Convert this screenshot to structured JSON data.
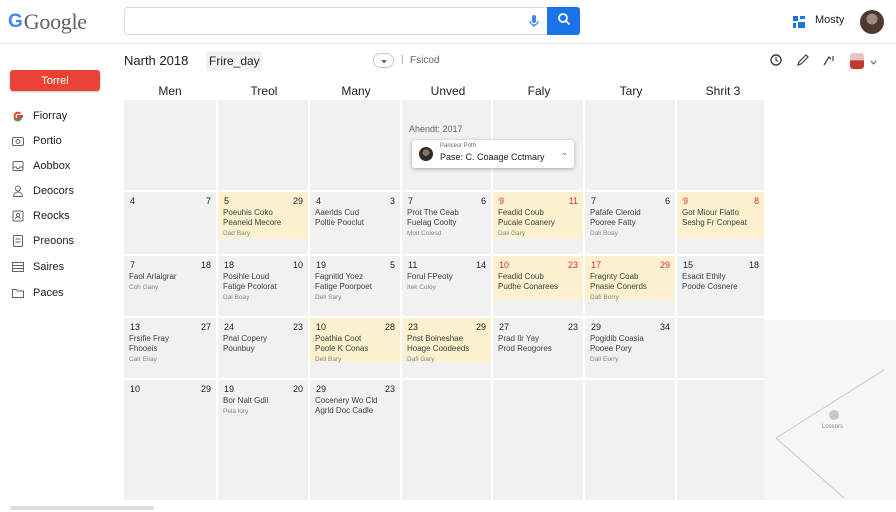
{
  "app": {
    "logo_g": "G",
    "logo_word": "Google"
  },
  "search": {
    "value": "",
    "placeholder": ""
  },
  "user": {
    "name": "Mosty"
  },
  "sidebar": {
    "create_label": "Torrel",
    "items": [
      {
        "label": "Fiorray",
        "icon": "google-g-icon"
      },
      {
        "label": "Portio",
        "icon": "camera-icon"
      },
      {
        "label": "Aobbox",
        "icon": "inbox-icon"
      },
      {
        "label": "Deocors",
        "icon": "person-icon"
      },
      {
        "label": "Reocks",
        "icon": "contacts-icon"
      },
      {
        "label": "Preoons",
        "icon": "document-icon"
      },
      {
        "label": "Saires",
        "icon": "list-icon"
      },
      {
        "label": "Paces",
        "icon": "folder-icon"
      }
    ]
  },
  "header": {
    "month": "Narth 2018",
    "view": "Frire_day",
    "filter": "Fsicod",
    "separator": "|"
  },
  "days_of_week": [
    "Men",
    "Treol",
    "Many",
    "Unved",
    "Faly",
    "Tary",
    "Shrit 3"
  ],
  "week0": {
    "label": "Ahendt: 2017",
    "popover": {
      "line1": "Pancesr Poth",
      "line2": "Pase: C. Coaage Cctmary"
    }
  },
  "weeks": [
    {
      "cells": [
        {
          "l": "4",
          "r": "7",
          "events": [],
          "hl": false
        },
        {
          "l": "5",
          "r": "29",
          "events": [
            "Poeuhis Coko",
            "Peaneid Mecore"
          ],
          "sub": "Dad Bary",
          "hl": true
        },
        {
          "l": "4",
          "r": "3",
          "events": [
            "Aaerlds Cud",
            "Poltie Pooclut"
          ],
          "sub": "",
          "hl": false
        },
        {
          "l": "7",
          "r": "6",
          "events": [
            "Prot The Ceab",
            "Fuelag Coolty"
          ],
          "sub": "Moit Colesd",
          "hl": false
        },
        {
          "l": "9",
          "r": "11",
          "events": [
            "Feadid Coub",
            "Pucale Coanery"
          ],
          "sub": "Dali Gary",
          "hl": true
        },
        {
          "l": "7",
          "r": "6",
          "events": [
            "Pafafe Cleroid",
            "Pooree Fatty"
          ],
          "sub": "Dali Boay",
          "hl": false
        },
        {
          "l": "9",
          "r": "8",
          "events": [
            "Got Miour Flatlo",
            "Seshg Fr Conpeat"
          ],
          "sub": "",
          "hl": true
        }
      ]
    },
    {
      "cells": [
        {
          "l": "7",
          "r": "18",
          "events": [
            "Faol Arlaigrar"
          ],
          "sub": "Coh Gany",
          "hl": false
        },
        {
          "l": "18",
          "r": "10",
          "events": [
            "Posihle Loud",
            "Fatige Pcolorat"
          ],
          "sub": "Dal Boay",
          "hl": false
        },
        {
          "l": "19",
          "r": "5",
          "events": [
            "Fagnitid Yoez",
            "Fatige Poorpoet"
          ],
          "sub": "Dell Sary",
          "hl": false
        },
        {
          "l": "11",
          "r": "14",
          "events": [
            "Forul FPeoty"
          ],
          "sub": "Itek Coloy",
          "hl": false
        },
        {
          "l": "10",
          "r": "23",
          "events": [
            "Feadid Coub",
            "Pudhe Conarees"
          ],
          "sub": "",
          "hl": true
        },
        {
          "l": "17",
          "r": "29",
          "events": [
            "Fragnty Coab",
            "Pnasie Conerds"
          ],
          "sub": "Dafi Borry",
          "hl": true
        },
        {
          "l": "15",
          "r": "18",
          "events": [
            "Esacit Ethily",
            "Poode Cosnere"
          ],
          "sub": "",
          "hl": false
        }
      ]
    },
    {
      "cells": [
        {
          "l": "13",
          "r": "27",
          "events": [
            "Frsifie Fray",
            "Fhooeis"
          ],
          "sub": "Cair Eilay",
          "hl": false
        },
        {
          "l": "24",
          "r": "23",
          "events": [
            "Pnal Copery",
            "Pounbuy"
          ],
          "sub": "",
          "hl": false
        },
        {
          "l": "10",
          "r": "28",
          "events": [
            "Poathia Coot",
            "Poole K Conas"
          ],
          "sub": "Dell Bary",
          "hl": true
        },
        {
          "l": "23",
          "r": "29",
          "events": [
            "Pnst Boineshae",
            "Hoage Coodeeds"
          ],
          "sub": "Dafi Gary",
          "hl": true
        },
        {
          "l": "27",
          "r": "23",
          "events": [
            "Prad Ilr Yay",
            "Prod Reogores"
          ],
          "sub": "",
          "hl": false
        },
        {
          "l": "29",
          "r": "34",
          "events": [
            "Pogidib Coasia",
            "Pooee Pory"
          ],
          "sub": "Dall Eorry",
          "hl": false
        },
        {
          "l": "",
          "r": "",
          "events": [],
          "sub": "",
          "hl": false
        }
      ]
    },
    {
      "cells": [
        {
          "l": "10",
          "r": "29",
          "events": [],
          "sub": "",
          "hl": false
        },
        {
          "l": "19",
          "r": "20",
          "events": [
            "Bor Nalt Gdil"
          ],
          "sub": "Pela lory",
          "hl": false
        },
        {
          "l": "29",
          "r": "23",
          "events": [
            "Cocenery Wo Cld",
            "Agrld Doc Cadle"
          ],
          "sub": "",
          "hl": false
        },
        {
          "l": "",
          "r": "",
          "events": [],
          "sub": "",
          "hl": false
        },
        {
          "l": "",
          "r": "",
          "events": [],
          "sub": "",
          "hl": false
        },
        {
          "l": "",
          "r": "",
          "events": [],
          "sub": "",
          "hl": false
        },
        {
          "l": "",
          "r": "",
          "events": [],
          "sub": "",
          "hl": false
        }
      ]
    }
  ],
  "envelope_label": "Lossors",
  "colors": {
    "accent": "#1a73e8",
    "create": "#ea4335",
    "highlight": "#fdf0cf",
    "red_date": "#d93025"
  }
}
